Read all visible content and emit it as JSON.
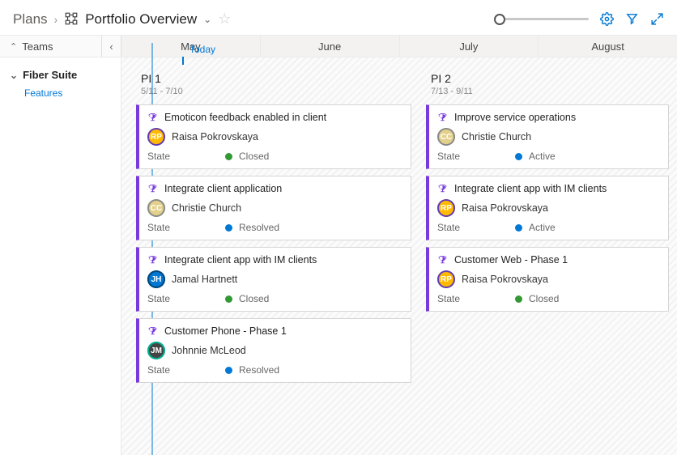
{
  "breadcrumb": {
    "root": "Plans",
    "title": "Portfolio Overview"
  },
  "today_label": "Today",
  "teams_header": "Teams",
  "months": [
    "May",
    "June",
    "July",
    "August"
  ],
  "sidebar": {
    "team": "Fiber Suite",
    "features_link": "Features"
  },
  "state_label": "State",
  "states": {
    "Closed": {
      "label": "Closed",
      "color": "#339933"
    },
    "Resolved": {
      "label": "Resolved",
      "color": "#0078d4"
    },
    "Active": {
      "label": "Active",
      "color": "#0078d4"
    }
  },
  "people": {
    "raisa": {
      "name": "Raisa Pokrovskaya",
      "bg": "#ffb900",
      "ring": "#603cba"
    },
    "christie": {
      "name": "Christie Church",
      "bg": "#e3d08a",
      "ring": "#8a8a8a"
    },
    "jamal": {
      "name": "Jamal Hartnett",
      "bg": "#0078d4",
      "ring": "#004578"
    },
    "johnnie": {
      "name": "Johnnie McLeod",
      "bg": "#444444",
      "ring": "#00b294"
    }
  },
  "columns": [
    {
      "title": "PI 1",
      "dates": "5/11 - 7/10",
      "cards": [
        {
          "title": "Emoticon feedback enabled in client",
          "person": "raisa",
          "state": "Closed"
        },
        {
          "title": "Integrate client application",
          "person": "christie",
          "state": "Resolved"
        },
        {
          "title": "Integrate client app with IM clients",
          "person": "jamal",
          "state": "Closed"
        },
        {
          "title": "Customer Phone - Phase 1",
          "person": "johnnie",
          "state": "Resolved"
        }
      ]
    },
    {
      "title": "PI 2",
      "dates": "7/13 - 9/11",
      "cards": [
        {
          "title": "Improve service operations",
          "person": "christie",
          "state": "Active"
        },
        {
          "title": "Integrate client app with IM clients",
          "person": "raisa",
          "state": "Active"
        },
        {
          "title": "Customer Web - Phase 1",
          "person": "raisa",
          "state": "Closed"
        }
      ]
    }
  ]
}
